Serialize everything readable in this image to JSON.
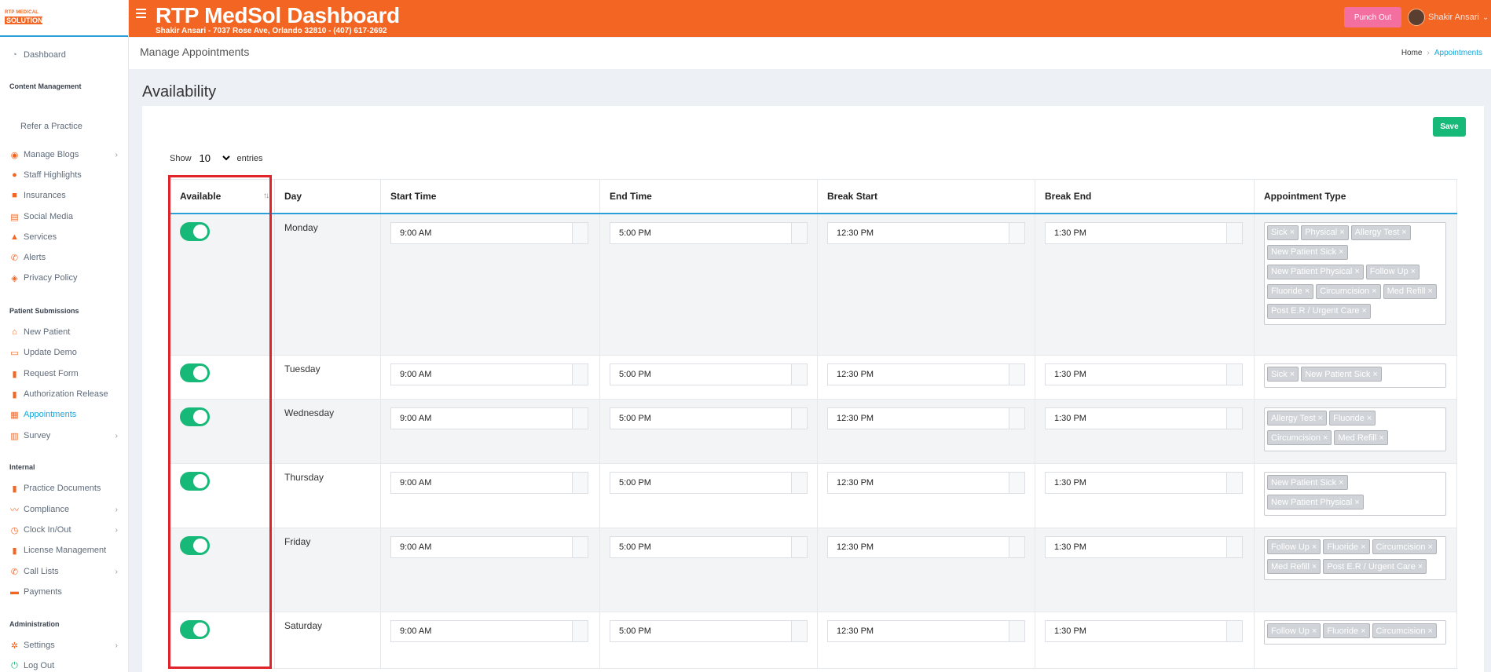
{
  "logo": {
    "line1": "RTP MEDICAL",
    "line2": "SOLUTION"
  },
  "header": {
    "title": "RTP MedSol Dashboard",
    "subtitle": "Shakir Ansari - 7037 Rose Ave, Orlando 32810 - (407) 617-2692",
    "punch_label": "Punch Out",
    "user_name": "Shakir Ansari"
  },
  "colors": {
    "brand": "#f26522",
    "accent": "#1ba6d9",
    "success": "#17b978",
    "highlight": "#e0242a"
  },
  "sidebar": {
    "dashboard": "Dashboard",
    "heading_content": "Content Management",
    "refer": "Refer a Practice",
    "manage_blogs": "Manage Blogs",
    "staff_highlights": "Staff Highlights",
    "insurances": "Insurances",
    "social_media": "Social Media",
    "services": "Services",
    "alerts": "Alerts",
    "privacy_policy": "Privacy Policy",
    "heading_patient": "Patient Submissions",
    "new_patient": "New Patient",
    "update_demo": "Update Demo",
    "request_form": "Request Form",
    "authorization_release": "Authorization Release",
    "appointments": "Appointments",
    "survey": "Survey",
    "heading_internal": "Internal",
    "practice_documents": "Practice Documents",
    "compliance": "Compliance",
    "clock": "Clock In/Out",
    "license": "License Management",
    "call_lists": "Call Lists",
    "payments": "Payments",
    "heading_admin": "Administration",
    "settings": "Settings",
    "logout": "Log Out"
  },
  "breadcrumb": {
    "page_title": "Manage Appointments",
    "home": "Home",
    "current": "Appointments"
  },
  "section_title": "Availability",
  "save_label": "Save",
  "entries": {
    "show": "Show",
    "value": "10",
    "suffix": "entries"
  },
  "table": {
    "headers": [
      "Available",
      "Day",
      "Start Time",
      "End Time",
      "Break Start",
      "Break End",
      "Appointment Type"
    ],
    "rows": [
      {
        "day": "Monday",
        "start": "9:00 AM",
        "end": "5:00 PM",
        "break_start": "12:30 PM",
        "break_end": "1:30 PM",
        "types": [
          "Sick",
          "Physical",
          "Allergy Test",
          "New Patient Sick",
          "New Patient Physical",
          "Follow Up",
          "Fluoride",
          "Circumcision",
          "Med Refill",
          "Post E.R / Urgent Care"
        ]
      },
      {
        "day": "Tuesday",
        "start": "9:00 AM",
        "end": "5:00 PM",
        "break_start": "12:30 PM",
        "break_end": "1:30 PM",
        "types": [
          "Sick",
          "New Patient Sick"
        ]
      },
      {
        "day": "Wednesday",
        "start": "9:00 AM",
        "end": "5:00 PM",
        "break_start": "12:30 PM",
        "break_end": "1:30 PM",
        "types": [
          "Allergy Test",
          "Fluoride",
          "Circumcision",
          "Med Refill"
        ]
      },
      {
        "day": "Thursday",
        "start": "9:00 AM",
        "end": "5:00 PM",
        "break_start": "12:30 PM",
        "break_end": "1:30 PM",
        "types": [
          "New Patient Sick",
          "New Patient Physical"
        ]
      },
      {
        "day": "Friday",
        "start": "9:00 AM",
        "end": "5:00 PM",
        "break_start": "12:30 PM",
        "break_end": "1:30 PM",
        "types": [
          "Follow Up",
          "Fluoride",
          "Circumcision",
          "Med Refill",
          "Post E.R / Urgent Care"
        ]
      },
      {
        "day": "Saturday",
        "start": "9:00 AM",
        "end": "5:00 PM",
        "break_start": "12:30 PM",
        "break_end": "1:30 PM",
        "types": [
          "Follow Up",
          "Fluoride",
          "Circumcision"
        ]
      }
    ]
  }
}
